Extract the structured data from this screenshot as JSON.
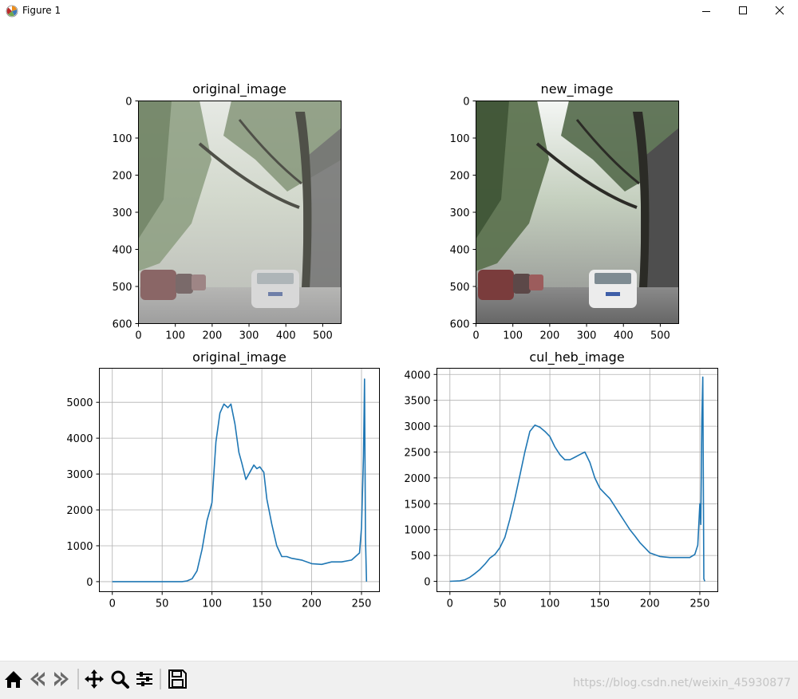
{
  "window": {
    "title": "Figure 1"
  },
  "colors": {
    "series": "#1f77b4",
    "grid": "#b0b0b0",
    "toolbar_bg": "#f0f0f0"
  },
  "toolbar": {
    "icons": [
      "home-icon",
      "back-icon",
      "forward-icon",
      "pan-icon",
      "zoom-icon",
      "configure-subplots-icon",
      "save-icon"
    ]
  },
  "watermark": "https://blog.csdn.net/weixin_45930877",
  "axes": {
    "image_x_ticks": [
      "0",
      "100",
      "200",
      "300",
      "400",
      "500"
    ],
    "image_y_ticks": [
      "0",
      "100",
      "200",
      "300",
      "400",
      "500",
      "600"
    ],
    "hist_x_ticks": [
      "0",
      "50",
      "100",
      "150",
      "200",
      "250"
    ]
  },
  "chart_data": [
    {
      "type": "image",
      "title": "original_image",
      "xlim": [
        0,
        550
      ],
      "ylim": [
        600,
        0
      ],
      "x_ticks": [
        0,
        100,
        200,
        300,
        400,
        500
      ],
      "y_ticks": [
        0,
        100,
        200,
        300,
        400,
        500,
        600
      ],
      "description_free": true
    },
    {
      "type": "image",
      "title": "new_image",
      "xlim": [
        0,
        550
      ],
      "ylim": [
        600,
        0
      ],
      "x_ticks": [
        0,
        100,
        200,
        300,
        400,
        500
      ],
      "y_ticks": [
        0,
        100,
        200,
        300,
        400,
        500,
        600
      ]
    },
    {
      "type": "line",
      "title": "original_image",
      "grid": true,
      "xlim": [
        -13,
        268
      ],
      "ylim": [
        -280,
        5950
      ],
      "x_ticks": [
        0,
        50,
        100,
        150,
        200,
        250
      ],
      "y_ticks": [
        0,
        1000,
        2000,
        3000,
        4000,
        5000
      ],
      "y_tick_labels": [
        "0",
        "1000",
        "2000",
        "3000",
        "4000",
        "5000"
      ],
      "series": [
        {
          "x": [
            0,
            50,
            70,
            75,
            80,
            85,
            90,
            95,
            100,
            104,
            108,
            112,
            116,
            119,
            123,
            127,
            130,
            134,
            138,
            142,
            145,
            148,
            152,
            155,
            160,
            165,
            170,
            175,
            180,
            190,
            200,
            210,
            220,
            230,
            240,
            248,
            250,
            252,
            253,
            254,
            255
          ],
          "y": [
            0,
            0,
            0,
            20,
            80,
            300,
            900,
            1700,
            2200,
            3900,
            4700,
            4950,
            4850,
            4950,
            4400,
            3600,
            3300,
            2850,
            3050,
            3250,
            3150,
            3200,
            3050,
            2300,
            1600,
            1000,
            700,
            700,
            650,
            600,
            500,
            480,
            550,
            550,
            600,
            800,
            1500,
            3500,
            5650,
            1200,
            0
          ]
        }
      ]
    },
    {
      "type": "line",
      "title": "cul_heb_image",
      "grid": true,
      "xlim": [
        -13,
        268
      ],
      "ylim": [
        -200,
        4120
      ],
      "x_ticks": [
        0,
        50,
        100,
        150,
        200,
        250
      ],
      "y_ticks": [
        0,
        500,
        1000,
        1500,
        2000,
        2500,
        3000,
        3500,
        4000
      ],
      "y_tick_labels": [
        "0",
        "500",
        "1000",
        "1500",
        "2000",
        "2500",
        "3000",
        "3500",
        "4000"
      ],
      "series": [
        {
          "x": [
            0,
            10,
            15,
            20,
            25,
            30,
            35,
            40,
            45,
            50,
            55,
            60,
            65,
            70,
            75,
            80,
            85,
            90,
            95,
            100,
            105,
            110,
            115,
            120,
            125,
            130,
            135,
            140,
            145,
            150,
            155,
            160,
            165,
            170,
            175,
            180,
            185,
            190,
            195,
            200,
            210,
            220,
            230,
            240,
            245,
            248,
            250,
            251,
            252,
            253,
            254,
            255
          ],
          "y": [
            0,
            10,
            30,
            80,
            150,
            230,
            330,
            450,
            520,
            650,
            850,
            1200,
            1600,
            2050,
            2500,
            2900,
            3020,
            2980,
            2900,
            2800,
            2600,
            2450,
            2350,
            2350,
            2400,
            2450,
            2500,
            2300,
            2000,
            1800,
            1700,
            1600,
            1450,
            1300,
            1150,
            1000,
            880,
            750,
            650,
            550,
            480,
            460,
            460,
            460,
            520,
            700,
            1500,
            1100,
            3100,
            3950,
            50,
            0
          ]
        }
      ]
    }
  ]
}
